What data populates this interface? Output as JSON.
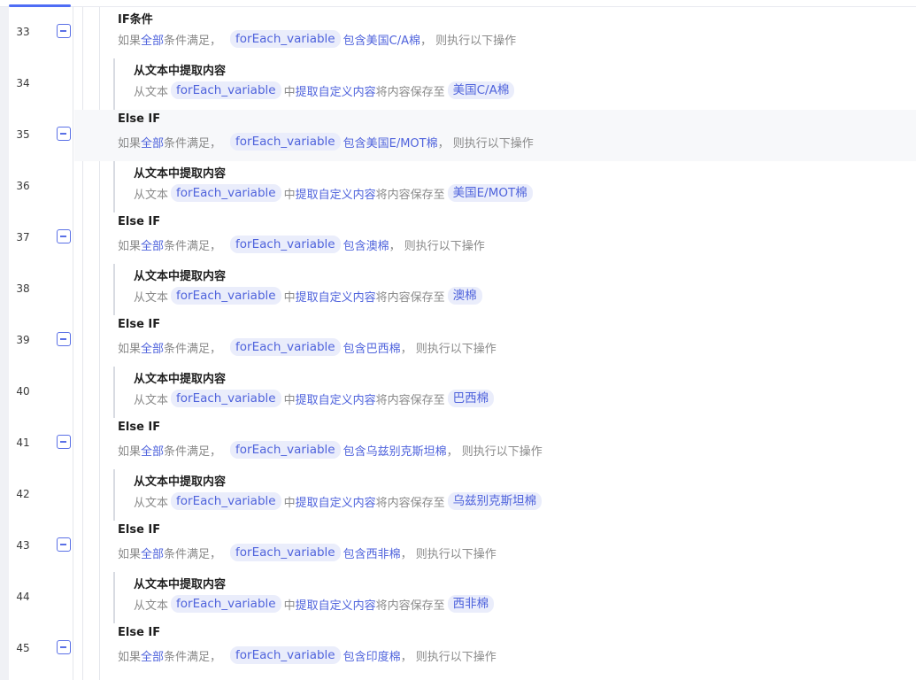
{
  "colors": {
    "accent": "#4f63dc",
    "chip_bg": "#eaedfb",
    "muted": "#8a8a8a",
    "highlight_row": "#f7f8fa"
  },
  "icons": {
    "collapse": "minus-square-icon"
  },
  "common": {
    "if_prefix": "如果",
    "all": "全部",
    "conditions_met": "条件满足，",
    "variable": "forEach_variable",
    "contains": "包含",
    "then_suffix": "， 则执行以下操作",
    "extract_title": "从文本中提取内容",
    "from_text": "从文本",
    "middle": "中",
    "extract_custom": "提取自定义内容",
    "save_to": "将内容保存至"
  },
  "rows": [
    {
      "line": "33",
      "kind": "condition",
      "title": "IF条件",
      "value": "美国C/A棉"
    },
    {
      "line": "34",
      "kind": "action",
      "target": "美国C/A棉"
    },
    {
      "line": "35",
      "kind": "condition",
      "title": "Else IF",
      "value": "美国E/MOT棉",
      "highlighted": true
    },
    {
      "line": "36",
      "kind": "action",
      "target": "美国E/MOT棉"
    },
    {
      "line": "37",
      "kind": "condition",
      "title": "Else IF",
      "value": "澳棉"
    },
    {
      "line": "38",
      "kind": "action",
      "target": "澳棉"
    },
    {
      "line": "39",
      "kind": "condition",
      "title": "Else IF",
      "value": "巴西棉"
    },
    {
      "line": "40",
      "kind": "action",
      "target": "巴西棉"
    },
    {
      "line": "41",
      "kind": "condition",
      "title": "Else IF",
      "value": "乌兹别克斯坦棉"
    },
    {
      "line": "42",
      "kind": "action",
      "target": "乌兹别克斯坦棉"
    },
    {
      "line": "43",
      "kind": "condition",
      "title": "Else IF",
      "value": "西非棉"
    },
    {
      "line": "44",
      "kind": "action",
      "target": "西非棉"
    },
    {
      "line": "45",
      "kind": "condition",
      "title": "Else IF",
      "value": "印度棉"
    }
  ]
}
